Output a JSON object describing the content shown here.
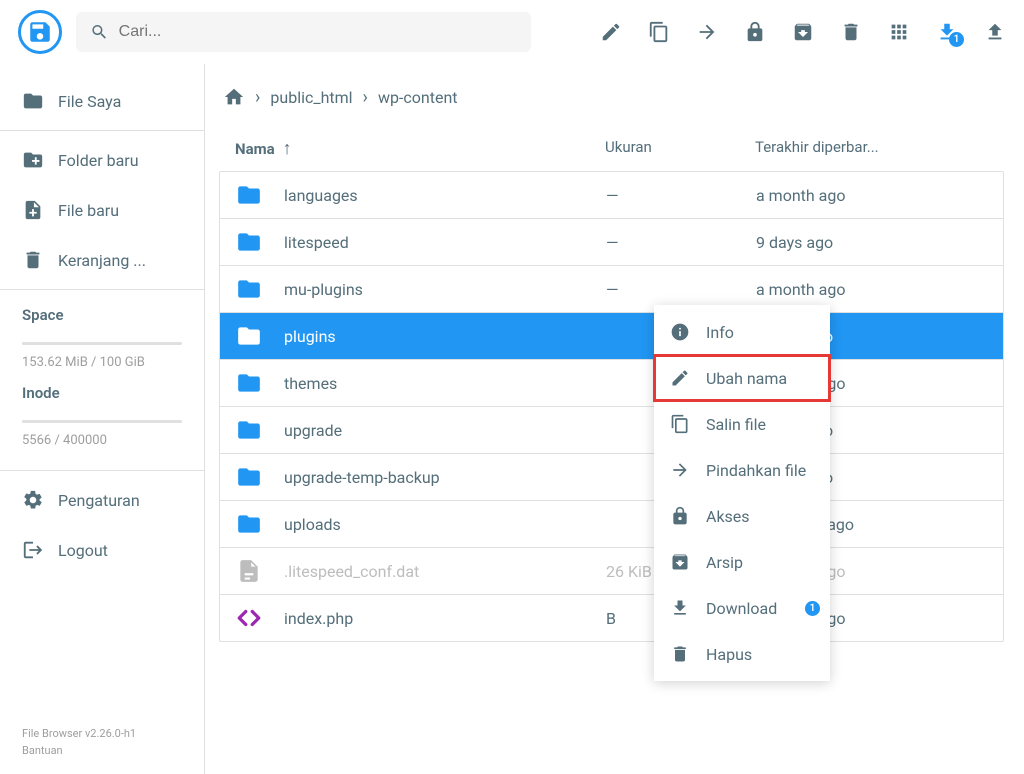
{
  "search": {
    "placeholder": "Cari..."
  },
  "toolbar": {
    "download_badge": "1"
  },
  "sidebar": {
    "items": [
      {
        "label": "File Saya"
      },
      {
        "label": "Folder baru"
      },
      {
        "label": "File baru"
      },
      {
        "label": "Keranjang ..."
      }
    ],
    "space": {
      "title": "Space",
      "stat": "153.62 MiB / 100 GiB"
    },
    "inode": {
      "title": "Inode",
      "stat": "5566 / 400000"
    },
    "settings": "Pengaturan",
    "logout": "Logout",
    "footer_version": "File Browser v2.26.0-h1",
    "footer_help": "Bantuan"
  },
  "breadcrumb": {
    "items": [
      "public_html",
      "wp-content"
    ]
  },
  "table": {
    "headers": {
      "name": "Nama",
      "size": "Ukuran",
      "date": "Terakhir diperbar..."
    },
    "rows": [
      {
        "name": "languages",
        "size": "—",
        "date": "a month ago",
        "type": "folder"
      },
      {
        "name": "litespeed",
        "size": "—",
        "date": "9 days ago",
        "type": "folder"
      },
      {
        "name": "mu-plugins",
        "size": "—",
        "date": "a month ago",
        "type": "folder"
      },
      {
        "name": "plugins",
        "size": "",
        "date": "9 days ago",
        "type": "folder",
        "selected": true
      },
      {
        "name": "themes",
        "size": "",
        "date": "a month ago",
        "type": "folder"
      },
      {
        "name": "upgrade",
        "size": "",
        "date": "8 days ago",
        "type": "folder"
      },
      {
        "name": "upgrade-temp-backup",
        "size": "",
        "date": "6 days ago",
        "type": "folder"
      },
      {
        "name": "uploads",
        "size": "",
        "date": "4 months ago",
        "type": "folder"
      },
      {
        "name": ".litespeed_conf.dat",
        "size": "26 KiB",
        "date": "a month ago",
        "type": "file",
        "dimmed": true
      },
      {
        "name": "index.php",
        "size": "B",
        "date": "a month ago",
        "type": "code"
      }
    ]
  },
  "context_menu": {
    "items": [
      {
        "label": "Info"
      },
      {
        "label": "Ubah nama",
        "highlighted": true
      },
      {
        "label": "Salin file"
      },
      {
        "label": "Pindahkan file"
      },
      {
        "label": "Akses"
      },
      {
        "label": "Arsip"
      },
      {
        "label": "Download",
        "badge": "1"
      },
      {
        "label": "Hapus"
      }
    ]
  }
}
